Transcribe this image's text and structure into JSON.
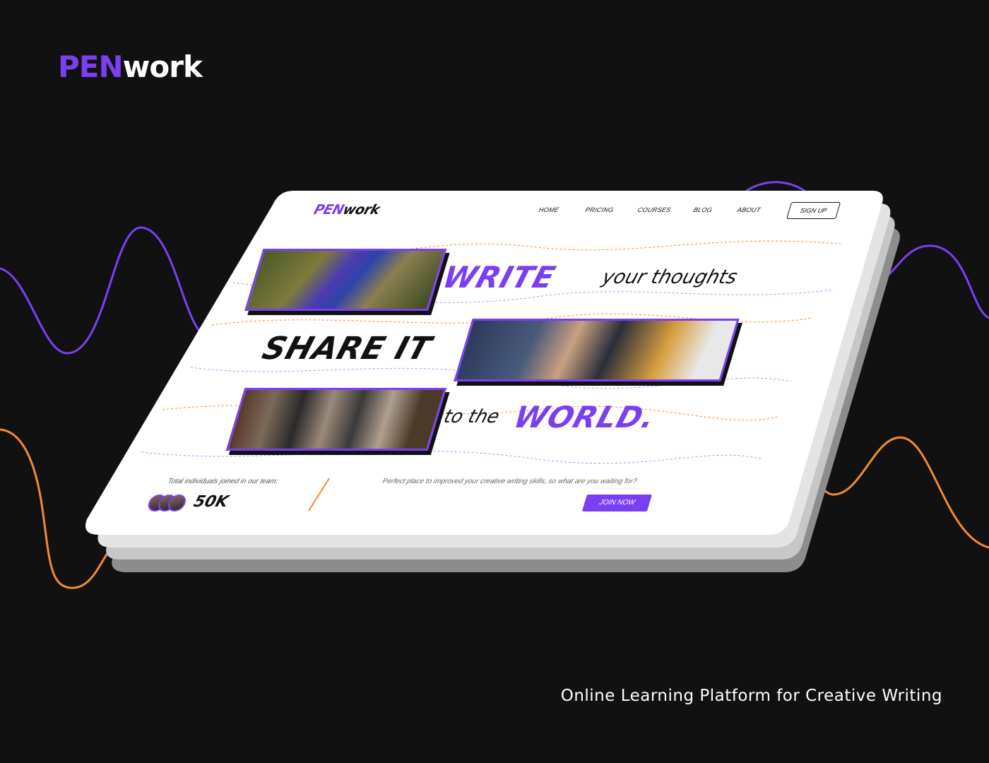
{
  "brand": {
    "logo_accent": "PEN",
    "logo_rest": "work"
  },
  "caption": "Online Learning Platform for Creative Writing",
  "colors": {
    "accent": "#7b3ff2",
    "orange": "#f28a2f",
    "background": "#111111"
  },
  "site": {
    "logo_accent": "PEN",
    "logo_rest": "work",
    "nav": [
      "HOME",
      "PRICING",
      "COURSES",
      "BLOG",
      "ABOUT"
    ],
    "signup_label": "SIGN UP",
    "hero": {
      "line1_big": "WRITE",
      "line1_small": "your thoughts",
      "line2_big": "SHARE IT",
      "line3_small": "to the",
      "line3_big": "WORLD."
    },
    "stats": {
      "label": "Total individuals joined in our team:",
      "count": "50K"
    },
    "tagline": "Perfect place to improved your creative writing skills, so what are you waiting for?",
    "join_label": "JOIN NOW"
  }
}
